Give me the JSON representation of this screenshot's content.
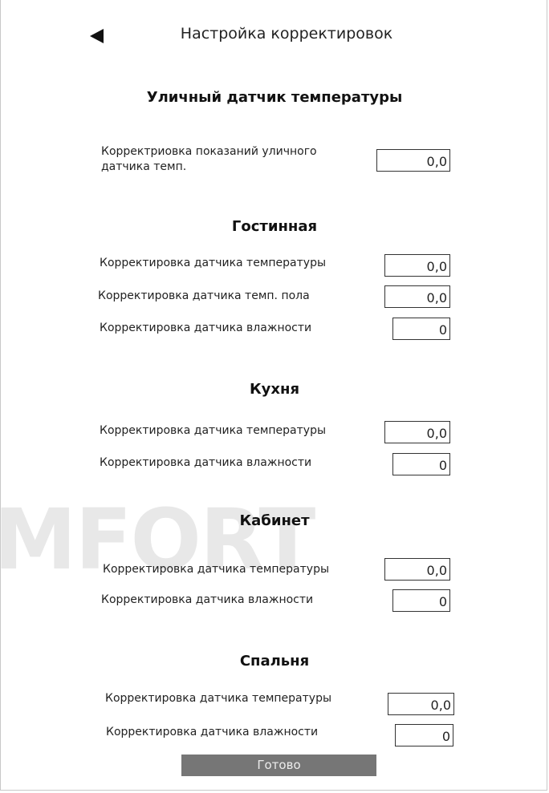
{
  "header": {
    "title": "Настройка корректировок"
  },
  "watermark": "MFORT",
  "outdoor": {
    "title": "Уличный датчик температуры",
    "label_line1": "Корректриовка показаний уличного",
    "label_line2": "датчика темп.",
    "value": "0,0"
  },
  "living": {
    "title": "Гостинная",
    "temp_label": "Корректировка датчика температуры",
    "temp_value": "0,0",
    "floor_label": "Корректировка датчика темп. пола",
    "floor_value": "0,0",
    "hum_label": "Корректировка датчика влажности",
    "hum_value": "0"
  },
  "kitchen": {
    "title": "Кухня",
    "temp_label": "Корректировка датчика температуры",
    "temp_value": "0,0",
    "hum_label": "Корректировка датчика влажности",
    "hum_value": "0"
  },
  "office": {
    "title": "Кабинет",
    "temp_label": "Корректировка датчика температуры",
    "temp_value": "0,0",
    "hum_label": "Корректировка датчика влажности",
    "hum_value": "0"
  },
  "bedroom": {
    "title": "Спальня",
    "temp_label": "Корректировка датчика температуры",
    "temp_value": "0,0",
    "hum_label": "Корректировка датчика влажности",
    "hum_value": "0"
  },
  "footer": {
    "done_label": "Готово"
  }
}
